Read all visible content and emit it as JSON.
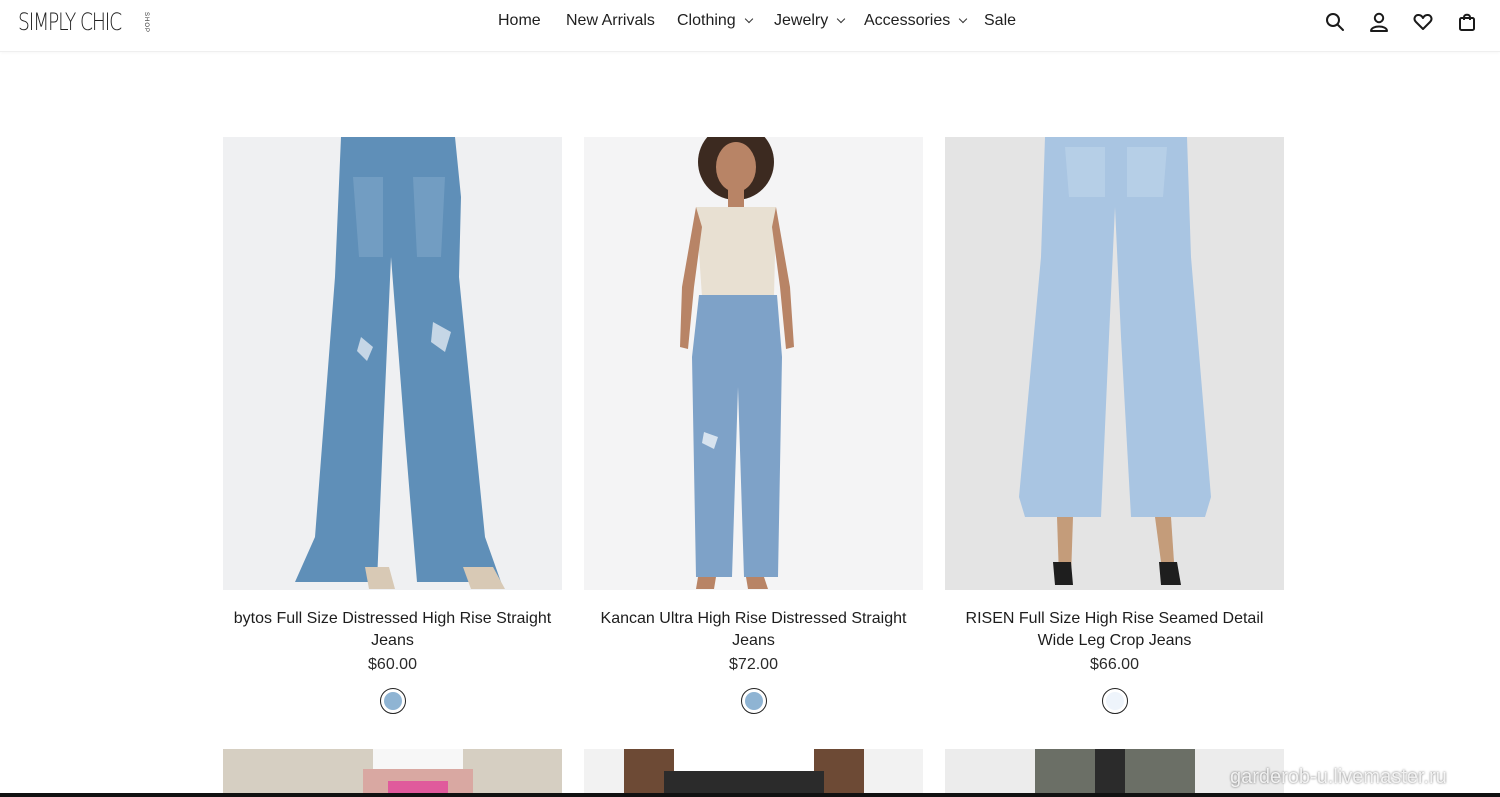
{
  "brand": {
    "logo_text": "SIMPLY CHIC",
    "logo_sub": "SHOP"
  },
  "nav": {
    "items": [
      {
        "label": "Home",
        "dropdown": false
      },
      {
        "label": "New Arrivals",
        "dropdown": false
      },
      {
        "label": "Clothing",
        "dropdown": true
      },
      {
        "label": "Jewelry",
        "dropdown": true
      },
      {
        "label": "Accessories",
        "dropdown": true
      },
      {
        "label": "Sale",
        "dropdown": false
      }
    ]
  },
  "header_icons": [
    "search-icon",
    "account-icon",
    "wishlist-heart-icon",
    "cart-bag-icon"
  ],
  "products": [
    {
      "title": "bytos Full Size Distressed High Rise Straight Jeans",
      "price": "$60.00",
      "swatch_color": "#8fb4d3",
      "denim_color": "#5f8fb8"
    },
    {
      "title": "Kancan Ultra High Rise Distressed Straight Jeans",
      "price": "$72.00",
      "swatch_color": "#8fb4d3",
      "denim_color": "#7ea2c8"
    },
    {
      "title": "RISEN Full Size High Rise Seamed Detail Wide Leg Crop Jeans",
      "price": "$66.00",
      "swatch_color": "#eef4fb",
      "denim_color": "#a9c5e2"
    }
  ],
  "watermark": "garderob-u.livemaster.ru"
}
